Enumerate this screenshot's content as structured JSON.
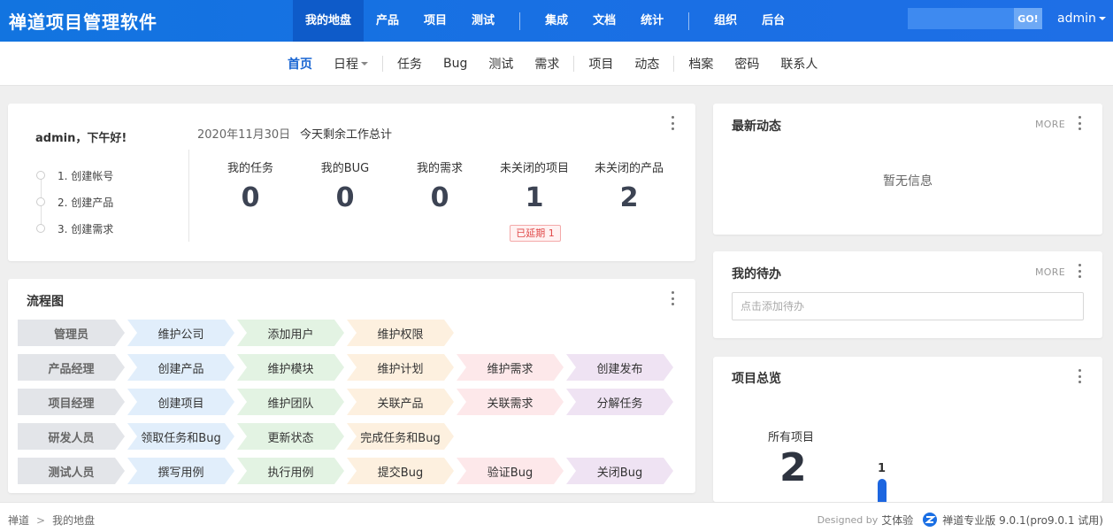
{
  "app": {
    "title": "禅道项目管理软件"
  },
  "main_nav": {
    "items": [
      {
        "label": "我的地盘",
        "active": true
      },
      {
        "label": "产品"
      },
      {
        "label": "项目"
      },
      {
        "label": "测试"
      },
      {
        "label": "集成"
      },
      {
        "label": "文档"
      },
      {
        "label": "统计"
      },
      {
        "label": "组织"
      },
      {
        "label": "后台"
      }
    ]
  },
  "search": {
    "value": "",
    "placeholder": "",
    "button_label": "GO!"
  },
  "user": {
    "name": "admin"
  },
  "sub_nav": {
    "items": [
      {
        "label": "首页",
        "active": true
      },
      {
        "label": "日程"
      },
      {
        "label": "任务"
      },
      {
        "label": "Bug"
      },
      {
        "label": "测试"
      },
      {
        "label": "需求"
      },
      {
        "label": "项目"
      },
      {
        "label": "动态"
      },
      {
        "label": "档案"
      },
      {
        "label": "密码"
      },
      {
        "label": "联系人"
      }
    ]
  },
  "welcome": {
    "greeting": "admin，下午好!",
    "steps": [
      "1. 创建帐号",
      "2. 创建产品",
      "3. 创建需求"
    ],
    "date": "2020年11月30日",
    "summary_label": "今天剩余工作总计",
    "stats": [
      {
        "label": "我的任务",
        "value": "0"
      },
      {
        "label": "我的BUG",
        "value": "0"
      },
      {
        "label": "我的需求",
        "value": "0"
      },
      {
        "label": "未关闭的项目",
        "value": "1"
      },
      {
        "label": "未关闭的产品",
        "value": "2"
      }
    ],
    "delay_badge": "已延期 1"
  },
  "flowchart": {
    "title": "流程图",
    "rows": [
      {
        "role": "管理员",
        "steps": [
          "维护公司",
          "添加用户",
          "维护权限"
        ]
      },
      {
        "role": "产品经理",
        "steps": [
          "创建产品",
          "维护模块",
          "维护计划",
          "维护需求",
          "创建发布"
        ]
      },
      {
        "role": "项目经理",
        "steps": [
          "创建项目",
          "维护团队",
          "关联产品",
          "关联需求",
          "分解任务"
        ]
      },
      {
        "role": "研发人员",
        "steps": [
          "领取任务和Bug",
          "更新状态",
          "完成任务和Bug"
        ]
      },
      {
        "role": "测试人员",
        "steps": [
          "撰写用例",
          "执行用例",
          "提交Bug",
          "验证Bug",
          "关闭Bug"
        ]
      }
    ],
    "step_colors": [
      "#e1eefb",
      "#e3f3e3",
      "#fdf0df",
      "#fde8ea",
      "#efe3f3"
    ]
  },
  "latest_dynamics": {
    "title": "最新动态",
    "more": "MORE",
    "empty_text": "暂无信息"
  },
  "my_todo": {
    "title": "我的待办",
    "more": "MORE",
    "input_placeholder": "点击添加待办"
  },
  "project_overview": {
    "title": "项目总览",
    "all_label": "所有项目",
    "all_count": "2",
    "bar_value": "1"
  },
  "footer": {
    "breadcrumb": [
      "禅道",
      "我的地盘"
    ],
    "designed_by": "Designed by",
    "brand": "艾体验",
    "version": "禅道专业版 9.0.1(pro9.0.1 试用)"
  },
  "colors": {
    "primary": "#1a6fe4",
    "accent": "#1a66d2",
    "danger": "#e04848"
  }
}
